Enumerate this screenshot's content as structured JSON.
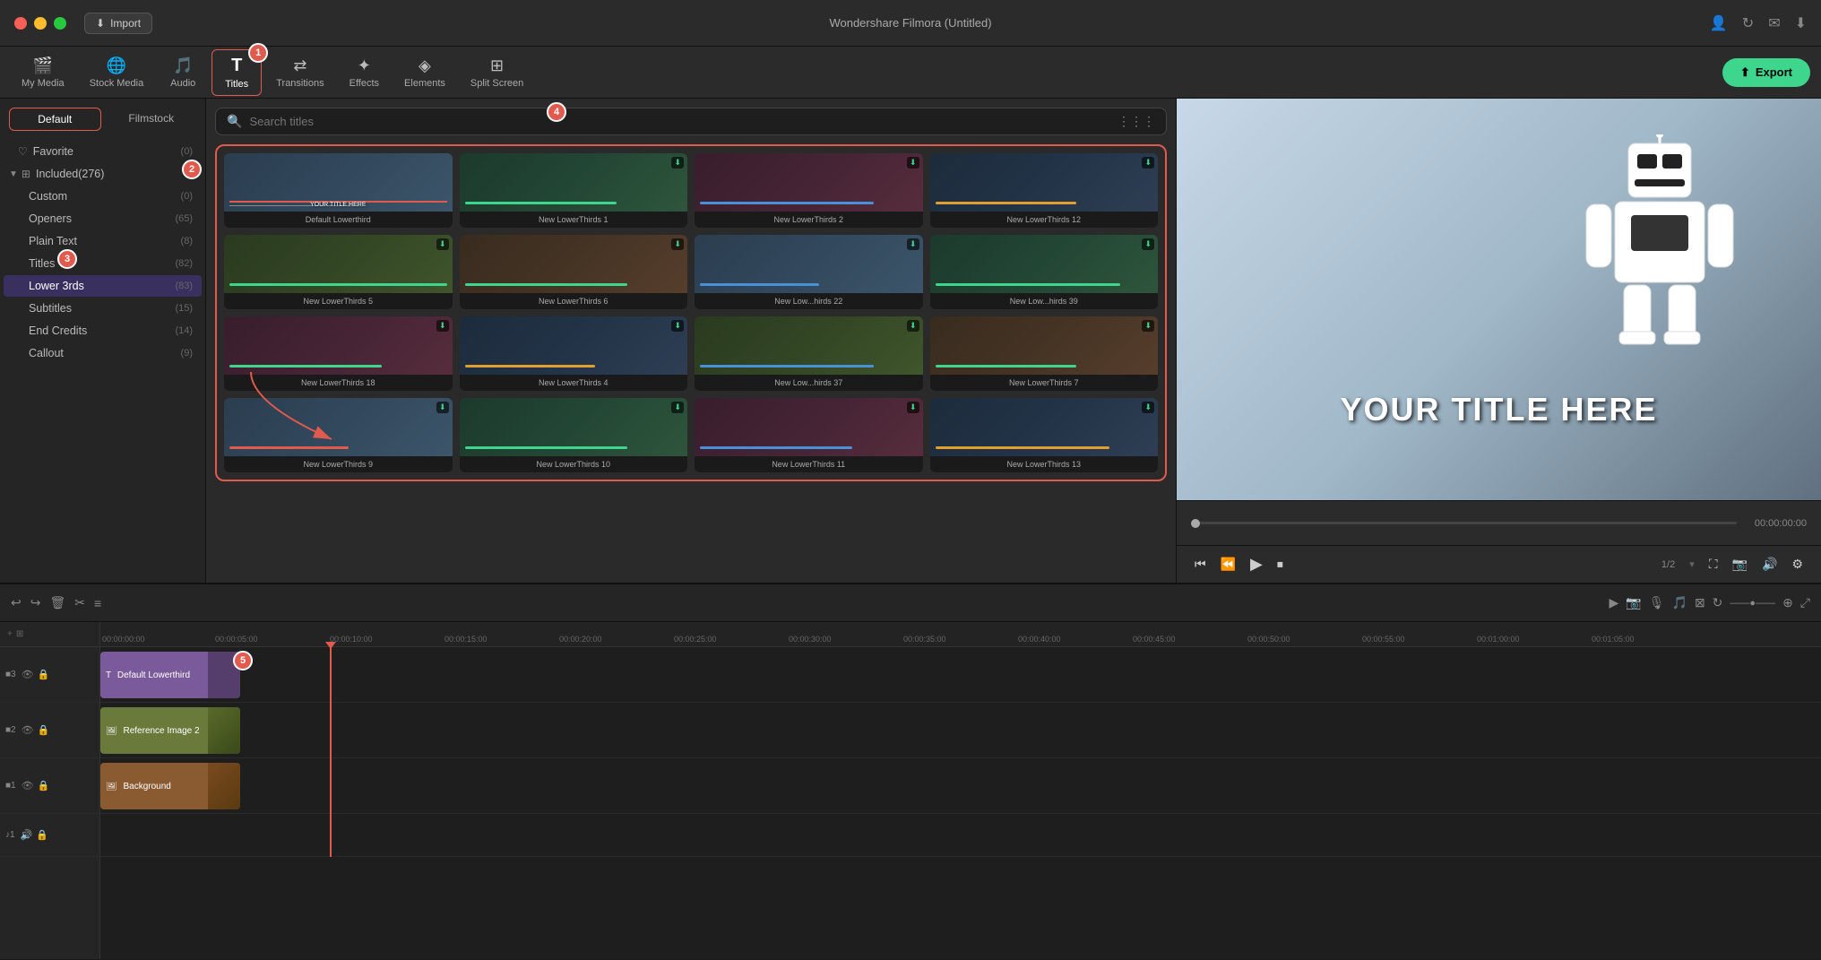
{
  "app": {
    "title": "Wondershare Filmora (Untitled)",
    "import_label": "Import"
  },
  "toolbar": {
    "items": [
      {
        "id": "my-media",
        "label": "My Media",
        "icon": "🎬"
      },
      {
        "id": "stock-media",
        "label": "Stock Media",
        "icon": "🌐"
      },
      {
        "id": "audio",
        "label": "Audio",
        "icon": "🎵"
      },
      {
        "id": "titles",
        "label": "Titles",
        "icon": "T"
      },
      {
        "id": "transitions",
        "label": "Transitions",
        "icon": "⇌"
      },
      {
        "id": "effects",
        "label": "Effects",
        "icon": "✦"
      },
      {
        "id": "elements",
        "label": "Elements",
        "icon": "◈"
      },
      {
        "id": "split-screen",
        "label": "Split Screen",
        "icon": "⊞"
      }
    ],
    "active": "titles",
    "export_label": "Export"
  },
  "sidebar": {
    "tabs": [
      {
        "id": "default",
        "label": "Default"
      },
      {
        "id": "filmstock",
        "label": "Filmstock"
      }
    ],
    "active_tab": "default",
    "items": [
      {
        "id": "favorite",
        "label": "Favorite",
        "count": "0",
        "indent": 0,
        "icon": "♡"
      },
      {
        "id": "included",
        "label": "Included",
        "count": "276",
        "indent": 0,
        "icon": "▼",
        "expanded": true
      },
      {
        "id": "custom",
        "label": "Custom",
        "count": "0",
        "indent": 1
      },
      {
        "id": "openers",
        "label": "Openers",
        "count": "65",
        "indent": 1
      },
      {
        "id": "plain-text",
        "label": "Plain Text",
        "count": "8",
        "indent": 1
      },
      {
        "id": "titles",
        "label": "Titles",
        "count": "82",
        "indent": 1
      },
      {
        "id": "lower-3rds",
        "label": "Lower 3rds",
        "count": "83",
        "indent": 1,
        "active": true
      },
      {
        "id": "subtitles",
        "label": "Subtitles",
        "count": "15",
        "indent": 1
      },
      {
        "id": "end-credits",
        "label": "End Credits",
        "count": "14",
        "indent": 1
      },
      {
        "id": "callout",
        "label": "Callout",
        "count": "9",
        "indent": 1
      }
    ],
    "badge2_label": "2"
  },
  "search": {
    "placeholder": "Search titles"
  },
  "titles_grid": {
    "items": [
      {
        "label": "Default Lowerthird",
        "color": "v1",
        "overlay": "#e05a4e"
      },
      {
        "label": "New LowerThirds 1",
        "color": "v2",
        "overlay": "#3dd68c"
      },
      {
        "label": "New LowerThirds 2",
        "color": "v3",
        "overlay": "#4a90d9"
      },
      {
        "label": "New LowerThirds 12",
        "color": "v4",
        "overlay": "#e0a030"
      },
      {
        "label": "New LowerThirds 5",
        "color": "v5",
        "overlay": "#3dd68c"
      },
      {
        "label": "New LowerThirds 6",
        "color": "v6",
        "overlay": "#3dd68c"
      },
      {
        "label": "New Low...hirds 22",
        "color": "v1",
        "overlay": "#4a90d9"
      },
      {
        "label": "New Low...hirds 39",
        "color": "v2",
        "overlay": "#3dd68c"
      },
      {
        "label": "New LowerThirds 18",
        "color": "v3",
        "overlay": "#3dd68c"
      },
      {
        "label": "New LowerThirds 4",
        "color": "v4",
        "overlay": "#e0a030"
      },
      {
        "label": "New Low...hirds 37",
        "color": "v5",
        "overlay": "#4a90d9"
      },
      {
        "label": "New LowerThirds 7",
        "color": "v6",
        "overlay": "#3dd68c"
      },
      {
        "label": "New LowerThirds 9",
        "color": "v1",
        "overlay": "#e05a4e"
      },
      {
        "label": "New LowerThirds 10",
        "color": "v2",
        "overlay": "#3dd68c"
      },
      {
        "label": "New LowerThirds 11",
        "color": "v3",
        "overlay": "#4a90d9"
      },
      {
        "label": "New LowerThirds 13",
        "color": "v4",
        "overlay": "#e0a030"
      }
    ]
  },
  "preview": {
    "title_text": "YOUR TITLE HERE",
    "time_current": "00:00:00:00",
    "time_duration": "1/2"
  },
  "timeline": {
    "tracks": [
      {
        "id": "track3",
        "num": "3",
        "type": "title",
        "clips": [
          {
            "label": "Default Lowerthird",
            "color": "#7a5a9a"
          }
        ]
      },
      {
        "id": "track2",
        "num": "2",
        "type": "video",
        "clips": [
          {
            "label": "Reference Image 2",
            "color": "#6a7a3a"
          }
        ]
      },
      {
        "id": "track1",
        "num": "1",
        "type": "video",
        "clips": [
          {
            "label": "Background",
            "color": "#8a5a30"
          }
        ]
      },
      {
        "id": "audio1",
        "num": "1",
        "type": "audio"
      }
    ],
    "ruler_times": [
      "00:00:00:00",
      "00:00:05:00",
      "00:00:10:00",
      "00:00:15:00",
      "00:00:20:00",
      "00:00:25:00",
      "00:00:30:00",
      "00:00:35:00",
      "00:00:40:00",
      "00:00:45:00",
      "00:00:50:00",
      "00:00:55:00",
      "00:01:00:00",
      "00:01:05:00"
    ]
  },
  "step_badges": [
    {
      "num": "1",
      "desc": "Titles toolbar badge"
    },
    {
      "num": "2",
      "desc": "Sidebar badge"
    },
    {
      "num": "3",
      "desc": "Lower 3rds badge"
    },
    {
      "num": "4",
      "desc": "Grid area badge"
    },
    {
      "num": "5",
      "desc": "Playhead badge"
    }
  ],
  "colors": {
    "accent": "#e05a4e",
    "green": "#3dd68c",
    "bg_dark": "#1e1e1e",
    "bg_mid": "#252525",
    "bg_light": "#2b2b2b"
  }
}
